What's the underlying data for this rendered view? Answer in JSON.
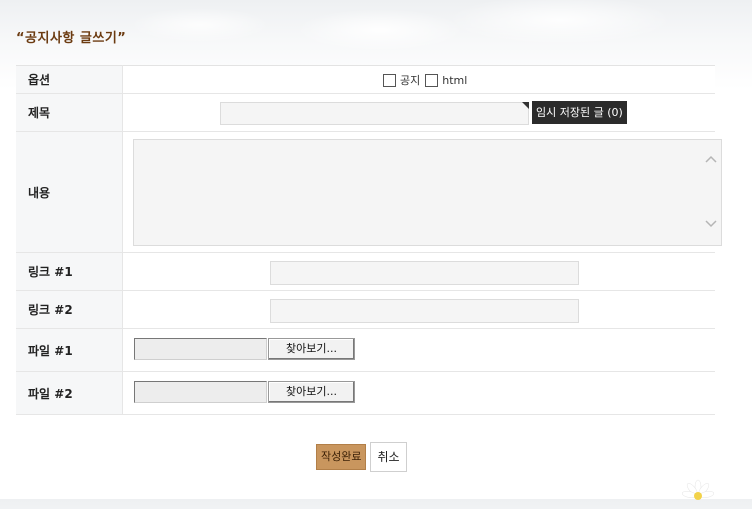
{
  "page": {
    "title": "“공지사항 글쓰기”"
  },
  "rows": {
    "option": {
      "label": "옵션",
      "notice_label": "공지",
      "html_label": "html"
    },
    "subject": {
      "label": "제목",
      "value": "",
      "temp_saved_button": "임시 저장된 글 (0)"
    },
    "content": {
      "label": "내용",
      "value": ""
    },
    "link1": {
      "label": "링크 #1",
      "value": ""
    },
    "link2": {
      "label": "링크 #2",
      "value": ""
    },
    "file1": {
      "label": "파일 #1",
      "browse_button": "찾아보기..."
    },
    "file2": {
      "label": "파일 #2",
      "browse_button": "찾아보기..."
    }
  },
  "actions": {
    "submit_label": "작성완료",
    "cancel_label": "취소"
  },
  "colors": {
    "title": "#6b3a10",
    "submit_bg": "#c9965e",
    "temp_save_bg": "#2b2b2b",
    "label_bg": "#f6f7f8"
  },
  "icons": {
    "scroll_up": "chevron-up-icon",
    "scroll_down": "chevron-down-icon",
    "decoration": "daisy-flower-icon"
  }
}
